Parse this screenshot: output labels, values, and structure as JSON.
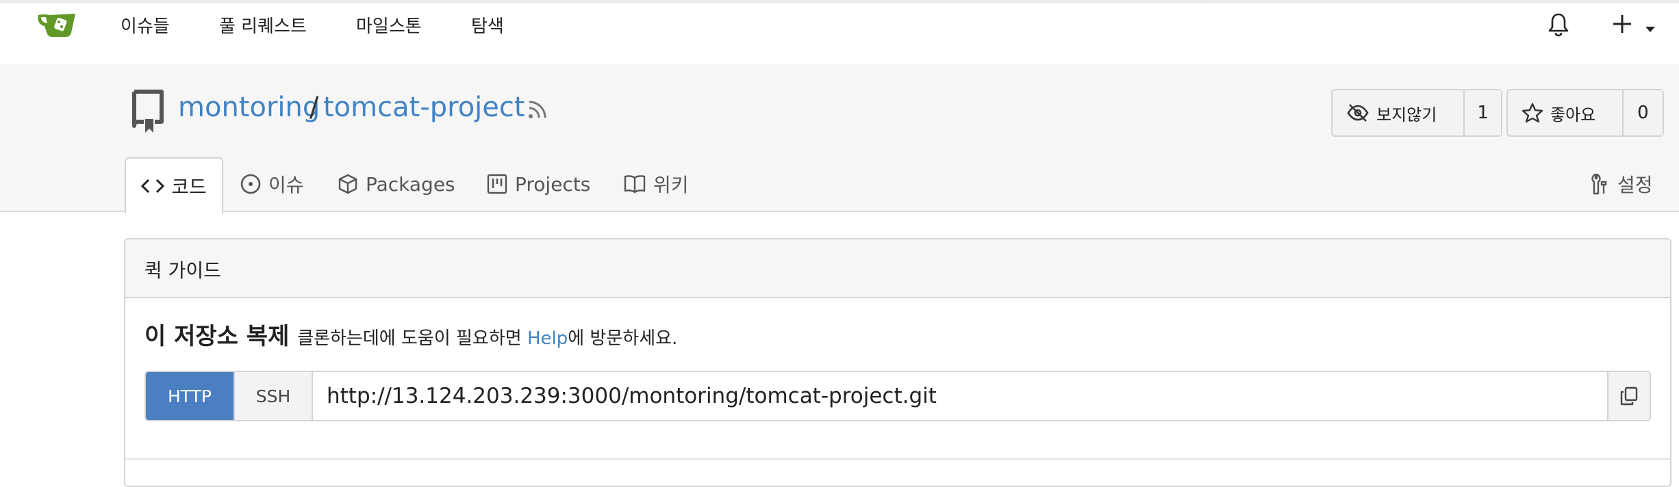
{
  "nav": {
    "items": [
      {
        "label": "이슈들"
      },
      {
        "label": "풀 리퀘스트"
      },
      {
        "label": "마일스톤"
      },
      {
        "label": "탐색"
      }
    ]
  },
  "repo": {
    "owner": "montoring",
    "separator": "/",
    "name": "tomcat-project",
    "watch": {
      "label": "보지않기",
      "count": "1"
    },
    "star": {
      "label": "좋아요",
      "count": "0"
    }
  },
  "tabs": [
    {
      "label": "코드",
      "icon": "code-icon",
      "active": true
    },
    {
      "label": "이슈",
      "icon": "issue-icon"
    },
    {
      "label": "Packages",
      "icon": "package-icon"
    },
    {
      "label": "Projects",
      "icon": "project-icon"
    },
    {
      "label": "위키",
      "icon": "book-icon"
    }
  ],
  "settings": {
    "label": "설정",
    "icon": "tools-icon"
  },
  "quick_guide": {
    "title": "퀵 가이드",
    "clone_heading": "이 저장소 복제",
    "clone_help_before": "클론하는데에 도움이 필요하면 ",
    "clone_help_link": "Help",
    "clone_help_after": "에 방문하세요.",
    "http_label": "HTTP",
    "ssh_label": "SSH",
    "clone_url": "http://13.124.203.239:3000/montoring/tomcat-project.git"
  },
  "colors": {
    "accent": "#4183c4",
    "http_button": "#4a7fc1",
    "header_bg": "#f6f6f6",
    "logo_green": "#609926"
  }
}
